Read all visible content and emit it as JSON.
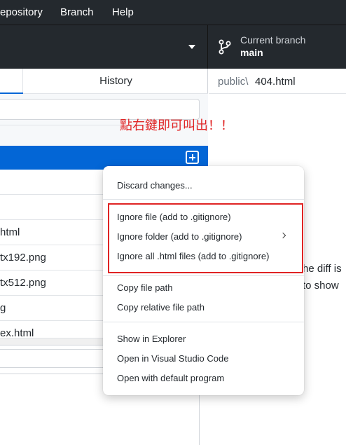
{
  "menubar": {
    "items": [
      "epository",
      "Branch",
      "Help"
    ]
  },
  "toolbar": {
    "branch_label": "Current branch",
    "branch_name": "main",
    "branch_icon": "git-branch-icon",
    "dropdown_icon": "caret-down-icon"
  },
  "tabs": {
    "history": "History"
  },
  "files": [
    "html",
    "tx192.png",
    "tx512.png",
    "g",
    "ex.html"
  ],
  "diff": {
    "path_dir": "public\\",
    "path_file": "404.html",
    "message_line1": "he diff is",
    "message_line2": "to show"
  },
  "annotation": "點右鍵即可叫出！！",
  "context_menu": {
    "discard": "Discard changes...",
    "ignore_file": "Ignore file (add to .gitignore)",
    "ignore_folder": "Ignore folder (add to .gitignore)",
    "ignore_all": "Ignore all .html files (add to .gitignore)",
    "copy_path": "Copy file path",
    "copy_relative": "Copy relative file path",
    "show_explorer": "Show in Explorer",
    "open_vscode": "Open in Visual Studio Code",
    "open_default": "Open with default program"
  },
  "colors": {
    "chrome_dark": "#24292e",
    "selection_blue": "#0366d6",
    "annotation_red": "#e02424"
  }
}
